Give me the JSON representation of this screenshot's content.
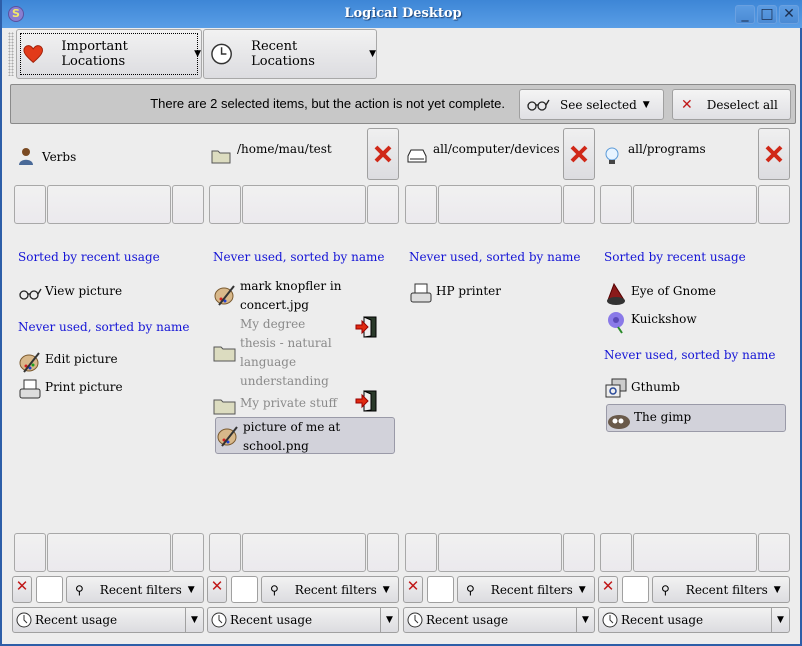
{
  "window": {
    "title": "Logical Desktop",
    "app_icon_letter": "S",
    "controls": {
      "minimize": "_",
      "maximize": "□",
      "close": "✕"
    }
  },
  "toolbar": {
    "buttons": [
      {
        "label": "Important Locations",
        "icon": "heart-icon",
        "arrow": "▼"
      },
      {
        "label": "Recent Locations",
        "icon": "clock-icon",
        "arrow": "▼"
      }
    ]
  },
  "status": {
    "message": "There are 2 selected items, but the action is not yet complete.",
    "see_selected_label": "See selected",
    "see_selected_arrow": "▼",
    "deselect_label": "Deselect all"
  },
  "columns": [
    {
      "path": "Verbs",
      "icon": "user-icon",
      "closable": false,
      "sections": [
        {
          "title": "Sorted by recent usage",
          "items": [
            {
              "label": "View picture",
              "icon": "glasses-icon"
            }
          ]
        },
        {
          "title": "Never used, sorted by name",
          "items": [
            {
              "label": "Edit picture",
              "icon": "paint-palette-icon"
            },
            {
              "label": "Print picture",
              "icon": "printer-icon"
            }
          ]
        }
      ]
    },
    {
      "path": "/home/mau/test",
      "icon": "folder-icon",
      "closable": true,
      "sections": [
        {
          "title": "Never used, sorted by name",
          "items": [
            {
              "label": "mark knopfler in concert.jpg",
              "icon": "paint-palette-icon"
            },
            {
              "label": "My degree thesis - natural language understanding",
              "icon": "folder-icon",
              "disabled": true,
              "action": "enter-door-icon"
            },
            {
              "label": "My private stuff",
              "icon": "folder-icon",
              "disabled": true,
              "action": "enter-door-icon"
            },
            {
              "label": "picture of me at school.png",
              "icon": "paint-palette-icon",
              "selected": true
            }
          ]
        }
      ]
    },
    {
      "path": "all/computer/devices",
      "icon": "drive-icon",
      "closable": true,
      "sections": [
        {
          "title": "Never used, sorted by name",
          "items": [
            {
              "label": "HP printer",
              "icon": "printer-icon"
            }
          ]
        }
      ]
    },
    {
      "path": "all/programs",
      "icon": "lightbulb-icon",
      "closable": true,
      "sections": [
        {
          "title": "Sorted by recent usage",
          "items": [
            {
              "label": "Eye of Gnome",
              "icon": "eog-icon"
            },
            {
              "label": "Kuickshow",
              "icon": "flower-icon"
            }
          ]
        },
        {
          "title": "Never used, sorted by name",
          "items": [
            {
              "label": "Gthumb",
              "icon": "gthumb-icon"
            },
            {
              "label": "The gimp",
              "icon": "gimp-icon",
              "selected": true
            }
          ]
        }
      ]
    }
  ],
  "filters": {
    "clear_symbol": "✕",
    "filter_input_value": "",
    "recent_filters_label": "Recent filters",
    "recent_filters_arrow": "▼",
    "sort_selected": "Recent usage",
    "sort_arrow": "▼"
  }
}
